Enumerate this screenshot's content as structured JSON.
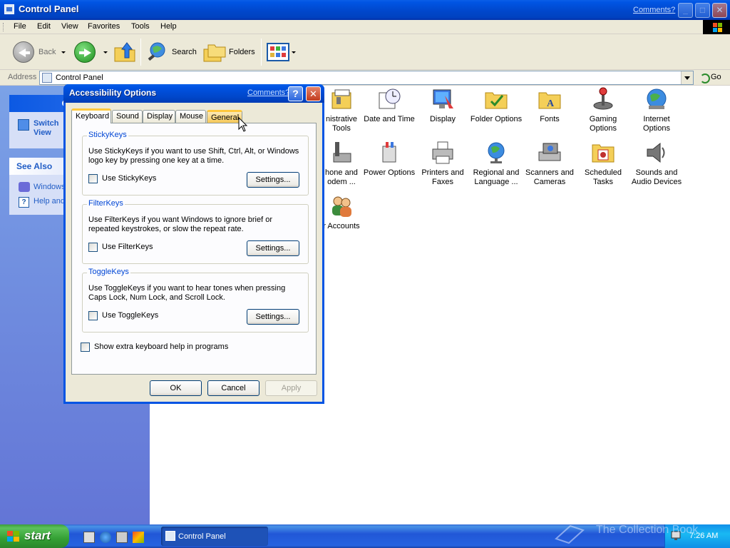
{
  "window": {
    "title": "Control Panel",
    "comments_link": "Comments?",
    "minimize": "_",
    "maximize": "□",
    "close": "✕"
  },
  "menu": [
    "File",
    "Edit",
    "View",
    "Favorites",
    "Tools",
    "Help"
  ],
  "toolbar": {
    "back_label": "Back",
    "search_label": "Search",
    "folders_label": "Folders"
  },
  "address": {
    "label": "Address",
    "value": "Control Panel",
    "go_label": "Go"
  },
  "left_pane": {
    "control_panel_header": "Control",
    "switch_view": "Switch\nView",
    "see_also_header": "See Also",
    "links": [
      "Windows",
      "Help and"
    ]
  },
  "icons": [
    {
      "label": "Administrative\nTools",
      "shown": "nistrative\nTools",
      "icon": "admin-tools-icon"
    },
    {
      "label": "Date and Time",
      "shown": "Date and Time",
      "icon": "clock-icon"
    },
    {
      "label": "Display",
      "shown": "Display",
      "icon": "display-icon"
    },
    {
      "label": "Folder Options",
      "shown": "Folder Options",
      "icon": "folder-icon"
    },
    {
      "label": "Fonts",
      "shown": "Fonts",
      "icon": "fonts-folder-icon"
    },
    {
      "label": "Gaming Options",
      "shown": "Gaming\nOptions",
      "icon": "joystick-icon"
    },
    {
      "label": "Internet Options",
      "shown": "Internet\nOptions",
      "icon": "globe-icon"
    },
    {
      "label": "Phone and Modem ...",
      "shown": "hone and\nodem ...",
      "icon": "phone-icon"
    },
    {
      "label": "Power Options",
      "shown": "Power Options",
      "icon": "power-icon"
    },
    {
      "label": "Printers and Faxes",
      "shown": "Printers and\nFaxes",
      "icon": "printer-icon"
    },
    {
      "label": "Regional and Language ...",
      "shown": "Regional and\nLanguage ...",
      "icon": "globe-stand-icon"
    },
    {
      "label": "Scanners and Cameras",
      "shown": "Scanners and\nCameras",
      "icon": "scanner-icon"
    },
    {
      "label": "Scheduled Tasks",
      "shown": "Scheduled\nTasks",
      "icon": "scheduled-tasks-icon"
    },
    {
      "label": "Sounds and Audio Devices",
      "shown": "Sounds and\nAudio Devices",
      "icon": "speaker-icon"
    },
    {
      "label": "User Accounts",
      "shown": "r Accounts",
      "icon": "users-icon"
    }
  ],
  "dialog": {
    "title": "Accessibility Options",
    "comments_link": "Comments?",
    "help": "?",
    "close": "✕",
    "tabs": [
      "Keyboard",
      "Sound",
      "Display",
      "Mouse",
      "General"
    ],
    "active_tab": "Keyboard",
    "hover_tab": "General",
    "groups": [
      {
        "label": "StickyKeys",
        "description": "Use StickyKeys if you want to use Shift, Ctrl, Alt, or Windows logo key by pressing one key at a time.",
        "checkbox": "Use StickyKeys",
        "checked": false,
        "settings": "Settings..."
      },
      {
        "label": "FilterKeys",
        "description": "Use FilterKeys if you want Windows to ignore brief or repeated keystrokes, or slow the repeat rate.",
        "checkbox": "Use FilterKeys",
        "checked": false,
        "settings": "Settings..."
      },
      {
        "label": "ToggleKeys",
        "description": "Use ToggleKeys if you want to hear tones when pressing Caps Lock, Num Lock, and Scroll Lock.",
        "checkbox": "Use ToggleKeys",
        "checked": false,
        "settings": "Settings..."
      }
    ],
    "extra_help_checkbox": "Show extra keyboard help in programs",
    "extra_help_checked": false,
    "ok": "OK",
    "cancel": "Cancel",
    "apply": "Apply"
  },
  "taskbar": {
    "start": "start",
    "task_button": "Control Panel",
    "clock": "7:26 AM",
    "watermark": "The Collection Book"
  },
  "colors": {
    "xp_blue": "#0054e3",
    "start_green": "#34a034",
    "tab_highlight": "#ffc83c",
    "group_label": "#0046d5"
  }
}
